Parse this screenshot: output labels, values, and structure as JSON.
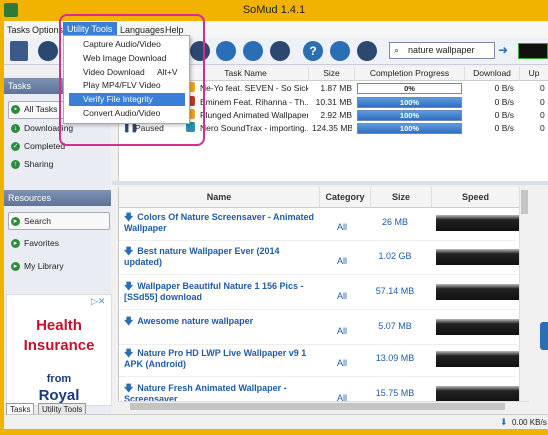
{
  "window": {
    "title": "SoMud 1.4.1"
  },
  "menubar": {
    "items": [
      "Tasks",
      "Options",
      "Utility Tools",
      "Languages",
      "Help"
    ]
  },
  "utility_menu": {
    "items": [
      {
        "label": "Capture Audio/Video",
        "shortcut": ""
      },
      {
        "label": "Web Image Download",
        "shortcut": ""
      },
      {
        "label": "Video Download",
        "shortcut": "Alt+V"
      },
      {
        "label": "Play MP4/FLV Video",
        "shortcut": ""
      },
      {
        "label": "Verify File Integrity",
        "shortcut": ""
      },
      {
        "label": "Convert Audio/Video",
        "shortcut": ""
      }
    ],
    "selected": "Verify File Integrity"
  },
  "search": {
    "value": "nature wallpaper"
  },
  "sidebar": {
    "tasks_header": "Tasks",
    "task_items": [
      "All Tasks",
      "Downloading",
      "Completed",
      "Sharing"
    ],
    "resources_header": "Resources",
    "resource_items": [
      "Search",
      "Favorites",
      "My Library"
    ]
  },
  "ad": {
    "line1": "Health",
    "line2": "Insurance",
    "line3": "from",
    "line4": "Royal"
  },
  "bottom_tabs": [
    "Tasks",
    "Utility Tools"
  ],
  "task_table": {
    "columns": [
      "Task Name",
      "Size",
      "Completion Progress",
      "Download",
      "Up"
    ],
    "rows": [
      {
        "status": "",
        "name": "Ne-Yo feat. SEVEN - So Sick ...",
        "size": "1.87 MB",
        "progress": 0,
        "progress_label": "0%",
        "download": "0 B/s",
        "up": "0"
      },
      {
        "status": "",
        "name": "Eminem  Feat. Rihanna - Th...",
        "size": "10.31 MB",
        "progress": 100,
        "progress_label": "100%",
        "download": "0 B/s",
        "up": "0"
      },
      {
        "status": "",
        "name": "Plunged Animated Wallpaper",
        "size": "2.92 MB",
        "progress": 100,
        "progress_label": "100%",
        "download": "0 B/s",
        "up": "0"
      },
      {
        "status": "Paused",
        "name": "Nero SoundTrax - importing...",
        "size": "124.35 MB",
        "progress": 100,
        "progress_label": "100%",
        "download": "0 B/s",
        "up": "0"
      }
    ]
  },
  "results": {
    "columns": [
      "Name",
      "Category",
      "Size",
      "Speed"
    ],
    "rows": [
      {
        "name": "Colors Of Nature Screensaver - Animated Wallpaper",
        "category": "All",
        "size": "26 MB"
      },
      {
        "name": "Best nature Wallpaper Ever (2014 updated)",
        "category": "All",
        "size": "1.02 GB"
      },
      {
        "name": "Wallpaper Beautiful Nature 1 156 Pics - [SSd55] download",
        "category": "All",
        "size": "57.14 MB"
      },
      {
        "name": "Awesome nature wallpaper",
        "category": "All",
        "size": "5.07 MB"
      },
      {
        "name": "Nature Pro HD LWP Live Wallpaper v9 1 APK (Android)",
        "category": "All",
        "size": "13.09 MB"
      },
      {
        "name": "Nature Fresh Animated Wallpaper - Screensaver",
        "category": "All",
        "size": "15.75 MB"
      }
    ]
  },
  "status": {
    "speed": "0.00 KB/s"
  },
  "colors": {
    "accent": "#3a7fd5",
    "callout": "#d82c8c",
    "titlebar": "#f2b300"
  }
}
